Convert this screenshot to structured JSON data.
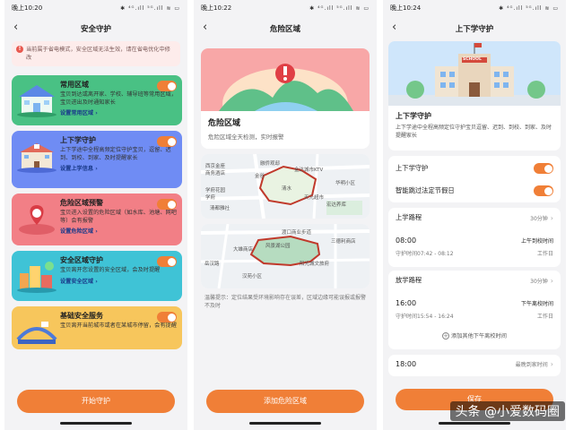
{
  "screen1": {
    "status_time": "晚上10:20",
    "status_icons": "✱ ⁴ᴳ.ıll ⁵ᴳ.ıll ≋ ▭",
    "title": "安全守护",
    "warning": "当前属于省电模式，安全区域无法生效，请在省电优化中修改",
    "cards": [
      {
        "title": "常用区域",
        "desc": "宝贝到达或离开家、学校、辅导班等常用区域，宝贝进出及时通知家长",
        "link": "设置常用区域 ›",
        "bg": "#49c184"
      },
      {
        "title": "上下学守护",
        "desc": "上下学途中全程高频定位守护宝贝，逗留、迟到、到校、到家、及时提醒家长",
        "link": "设置上学信息 ›",
        "bg": "#6f8cf4"
      },
      {
        "title": "危险区域预警",
        "desc": "宝贝进入设置的危险区域（如水库、池塘、网吧等）会有报警",
        "link": "设置危险区域 ›",
        "bg": "#f27f86"
      },
      {
        "title": "安全区域守护",
        "desc": "宝贝离开您设置的安全区域，会及时提醒",
        "link": "设置安全区域 ›",
        "bg": "#3fc3d6"
      },
      {
        "title": "基础安全服务",
        "desc": "宝贝离开当前城市或者在某城市停留，会有提醒",
        "link": "",
        "bg": "#f7c65c"
      }
    ],
    "button": "开始守护"
  },
  "screen2": {
    "status_time": "晚上10:22",
    "status_icons": "✱ ⁴ᴳ.ıll ⁵ᴳ.ıll ≋ ▭",
    "title": "危险区域",
    "hero_title": "危险区域",
    "hero_desc": "危险区域全天检测，实时报警",
    "map1_labels": [
      "融侨观邸",
      "西京金座",
      "商务酒店",
      "学府花园",
      "金谷",
      "清水",
      "金达城市KTV",
      "天元超市",
      "清都雅社",
      "宏达养库",
      "华明小区",
      "学府"
    ],
    "map2_labels": [
      "渡口商业步道",
      "三德利商店",
      "大雄商店",
      "风景湖公园",
      "阳光城文旅府",
      "汉苑小区",
      "岳汉路"
    ],
    "note": "温馨提示：定位结果受环境影响存在误差，区域边缘可能误报或报警不及时",
    "button": "添加危险区域"
  },
  "screen3": {
    "status_time": "晚上10:24",
    "status_icons": "✱ ⁴ᴳ.ıll ⁵ᴳ.ıll ≋ ▭",
    "title": "上下学守护",
    "school_sign": "SCHOOL",
    "hero_title": "上下学守护",
    "hero_desc": "上下学途中全程高频定位守护宝贝逗留、迟到、到校、到家、及时提醒家长",
    "toggle1": "上下学守护",
    "toggle2": "智能跳过法定节假日",
    "go_title": "上学路程",
    "go_duration": "30分钟",
    "go_time": "08:00",
    "go_range": "守护时间07:42 - 08:12",
    "go_type": "上午到校时间",
    "go_day": "工作日",
    "back_title": "放学路程",
    "back_duration": "30分钟",
    "back_time": "16:00",
    "back_range": "守护时间15:54 - 16:24",
    "back_type": "下午离校时间",
    "back_day": "工作日",
    "add_more": "添加其他下午离校时间",
    "home_time": "18:00",
    "home_label": "最晚到家时间",
    "button": "保存"
  },
  "watermark": "头条 @小爱数码圈"
}
